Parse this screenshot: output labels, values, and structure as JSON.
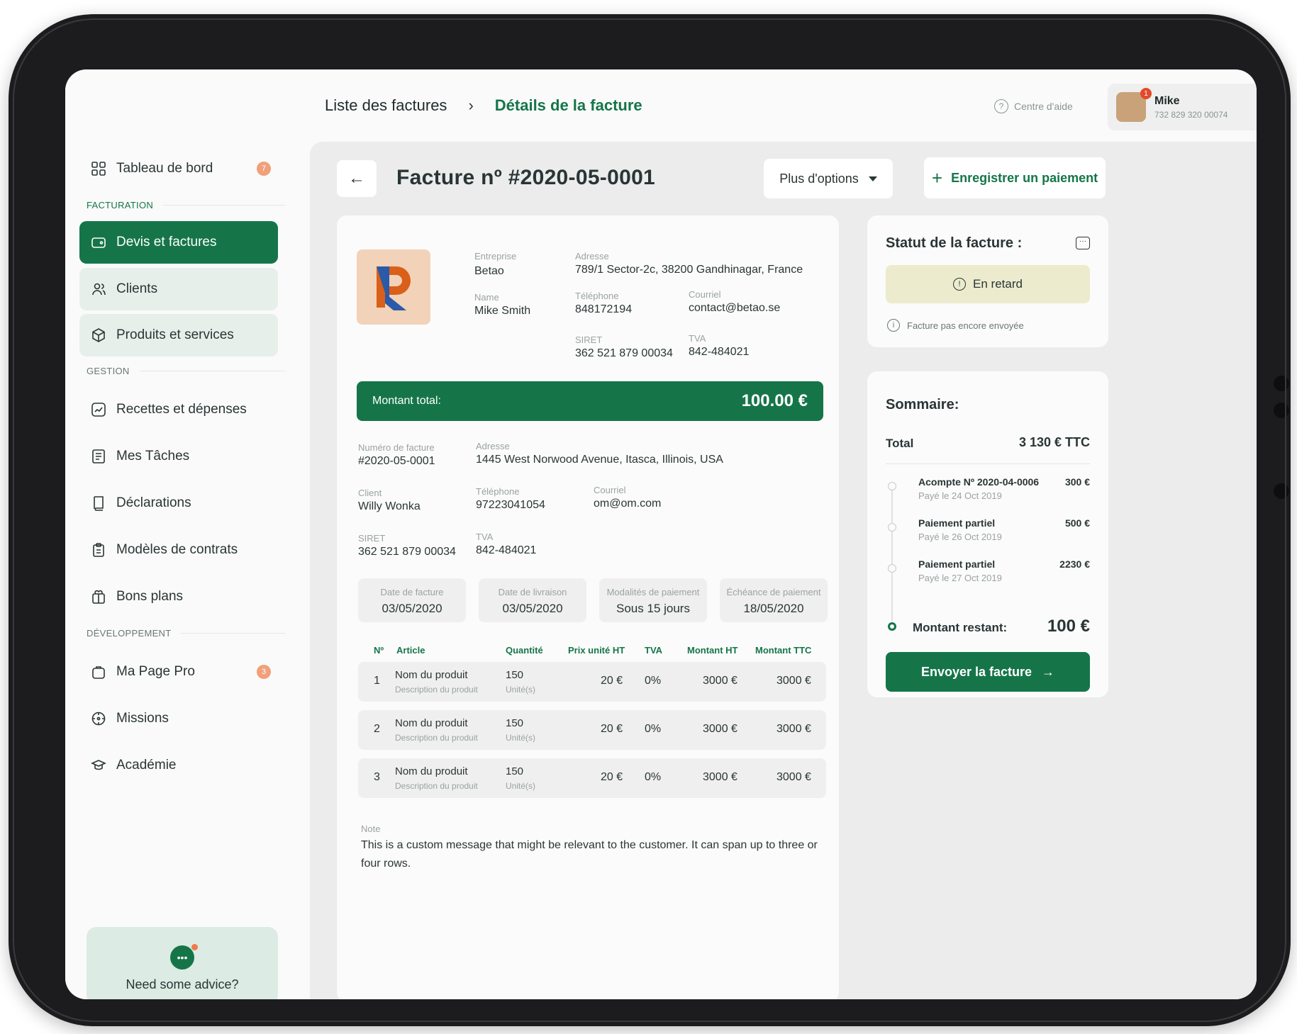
{
  "breadcrumb": {
    "parent": "Liste des factures",
    "separator": "›",
    "current": "Détails de la facture"
  },
  "help": {
    "label": "Centre d'aide"
  },
  "user": {
    "name": "Mike",
    "id": "732 829 320 00074",
    "notifications": "1"
  },
  "sidebar": {
    "dashboard": {
      "label": "Tableau de bord",
      "badge": "7"
    },
    "sections": {
      "billing": "FACTURATION",
      "management": "GESTION",
      "development": "DÉVELOPPEMENT"
    },
    "billing_items": [
      {
        "label": "Devis et factures"
      },
      {
        "label": "Clients"
      },
      {
        "label": "Produits et services"
      }
    ],
    "management_items": [
      {
        "label": "Recettes et dépenses"
      },
      {
        "label": "Mes Tâches"
      },
      {
        "label": "Déclarations"
      },
      {
        "label": "Modèles de contrats"
      },
      {
        "label": "Bons plans"
      }
    ],
    "development_items": [
      {
        "label": "Ma Page Pro",
        "badge": "3"
      },
      {
        "label": "Missions"
      },
      {
        "label": "Académie"
      }
    ],
    "advice": {
      "label": "Need some advice?"
    }
  },
  "invoice": {
    "title": "Facture nº #2020-05-0001",
    "more_options": "Plus d'options",
    "record_payment": "Enregistrer un paiement",
    "company": {
      "company_label": "Entreprise",
      "company": "Betao",
      "address_label": "Adresse",
      "address": "789/1 Sector-2c, 38200 Gandhinagar, France",
      "name_label": "Name",
      "name": "Mike Smith",
      "phone_label": "Téléphone",
      "phone": "848172194",
      "email_label": "Courriel",
      "email": "contact@betao.se",
      "siret_label": "SIRET",
      "siret": "362 521 879 00034",
      "tva_label": "TVA",
      "tva": "842-484021"
    },
    "total": {
      "label": "Montant total:",
      "value": "100.00 €"
    },
    "client": {
      "number_label": "Numéro de facture",
      "number": "#2020-05-0001",
      "address_label": "Adresse",
      "address": "1445 West Norwood Avenue, Itasca, Illinois, USA",
      "client_label": "Client",
      "client": "Willy Wonka",
      "phone_label": "Téléphone",
      "phone": "97223041054",
      "email_label": "Courriel",
      "email": "om@om.com",
      "siret_label": "SIRET",
      "siret": "362 521 879 00034",
      "tva_label": "TVA",
      "tva": "842-484021"
    },
    "dates": [
      {
        "label": "Date de facture",
        "value": "03/05/2020"
      },
      {
        "label": "Date de livraison",
        "value": "03/05/2020"
      },
      {
        "label": "Modalités de paiement",
        "value": "Sous 15 jours"
      },
      {
        "label": "Échéance de paiement",
        "value": "18/05/2020"
      }
    ],
    "table": {
      "headers": [
        "Nº",
        "Article",
        "Quantité",
        "Prix unité HT",
        "TVA",
        "Montant HT",
        "Montant TTC"
      ],
      "rows": [
        {
          "n": "1",
          "name": "Nom du produit",
          "desc": "Description du produit",
          "qty": "150",
          "unit": "Unité(s)",
          "price": "20 €",
          "tva": "0%",
          "ht": "3000 €",
          "ttc": "3000 €"
        },
        {
          "n": "2",
          "name": "Nom du produit",
          "desc": "Description du produit",
          "qty": "150",
          "unit": "Unité(s)",
          "price": "20 €",
          "tva": "0%",
          "ht": "3000 €",
          "ttc": "3000 €"
        },
        {
          "n": "3",
          "name": "Nom du produit",
          "desc": "Description du produit",
          "qty": "150",
          "unit": "Unité(s)",
          "price": "20 €",
          "tva": "0%",
          "ht": "3000 €",
          "ttc": "3000 €"
        }
      ]
    },
    "note": {
      "label": "Note",
      "text": "This is a custom message that might be relevant to the customer. It can span up to three or four rows."
    }
  },
  "status": {
    "title": "Statut de la facture :",
    "state": "En retard",
    "info": "Facture pas encore envoyée"
  },
  "summary": {
    "title": "Sommaire:",
    "total_label": "Total",
    "total_value": "3 130 € TTC",
    "payments": [
      {
        "name": "Acompte Nº 2020-04-0006",
        "date": "Payé le 24 Oct 2019",
        "value": "300 €"
      },
      {
        "name": "Paiement partiel",
        "date": "Payé le 26 Oct 2019",
        "value": "500 €"
      },
      {
        "name": "Paiement partiel",
        "date": "Payé le 27 Oct 2019",
        "value": "2230 €"
      }
    ],
    "remaining_label": "Montant restant:",
    "remaining_value": "100 €",
    "send_label": "Envoyer la facture"
  },
  "colors": {
    "brand": "#157549",
    "late_bg": "#ecebce",
    "badge": "#f0a07a"
  }
}
